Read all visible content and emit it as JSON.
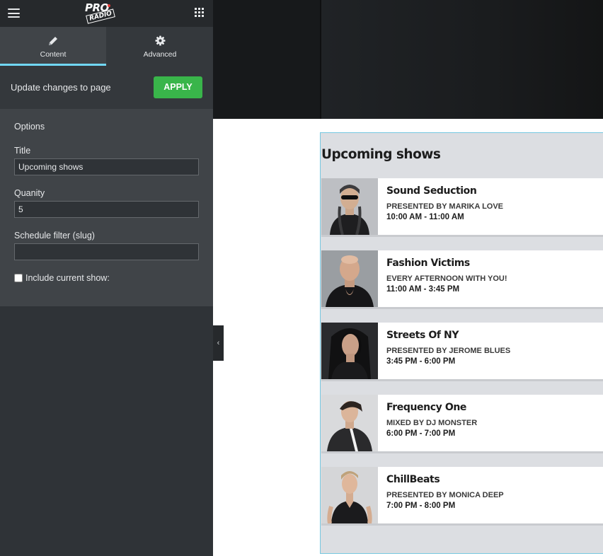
{
  "editor": {
    "tabs": [
      {
        "label": "Content",
        "icon": "pencil-icon"
      },
      {
        "label": "Advanced",
        "icon": "gear-icon"
      }
    ],
    "update_text": "Update changes to page",
    "apply_label": "APPLY",
    "section_title": "Options",
    "fields": {
      "title_label": "Title",
      "title_value": "Upcoming shows",
      "quantity_label": "Quanity",
      "quantity_value": "5",
      "filter_label": "Schedule filter (slug)",
      "filter_value": "",
      "include_current_label": "Include current show:"
    },
    "collapse_glyph": "‹"
  },
  "logo": {
    "line1": "PRO",
    "line2": "RADIO"
  },
  "preview": {
    "widget_title": "Upcoming shows",
    "shows": [
      {
        "name": "Sound Seduction",
        "host": "PRESENTED BY MARIKA LOVE",
        "time": "10:00 AM - 11:00 AM"
      },
      {
        "name": "Fashion Victims",
        "host": "EVERY AFTERNOON WITH YOU!",
        "time": "11:00 AM - 3:45 PM"
      },
      {
        "name": "Streets Of NY",
        "host": "PRESENTED BY JEROME BLUES",
        "time": "3:45 PM - 6:00 PM"
      },
      {
        "name": "Frequency One",
        "host": "MIXED BY DJ MONSTER",
        "time": "6:00 PM - 7:00 PM"
      },
      {
        "name": "ChillBeats",
        "host": "PRESENTED BY MONICA DEEP",
        "time": "7:00 PM - 8:00 PM"
      }
    ]
  },
  "colors": {
    "panel_bg": "#2f3337",
    "apply_green": "#39b54a",
    "active_tab_accent": "#71d7f7",
    "widget_border": "#76c8e0"
  }
}
